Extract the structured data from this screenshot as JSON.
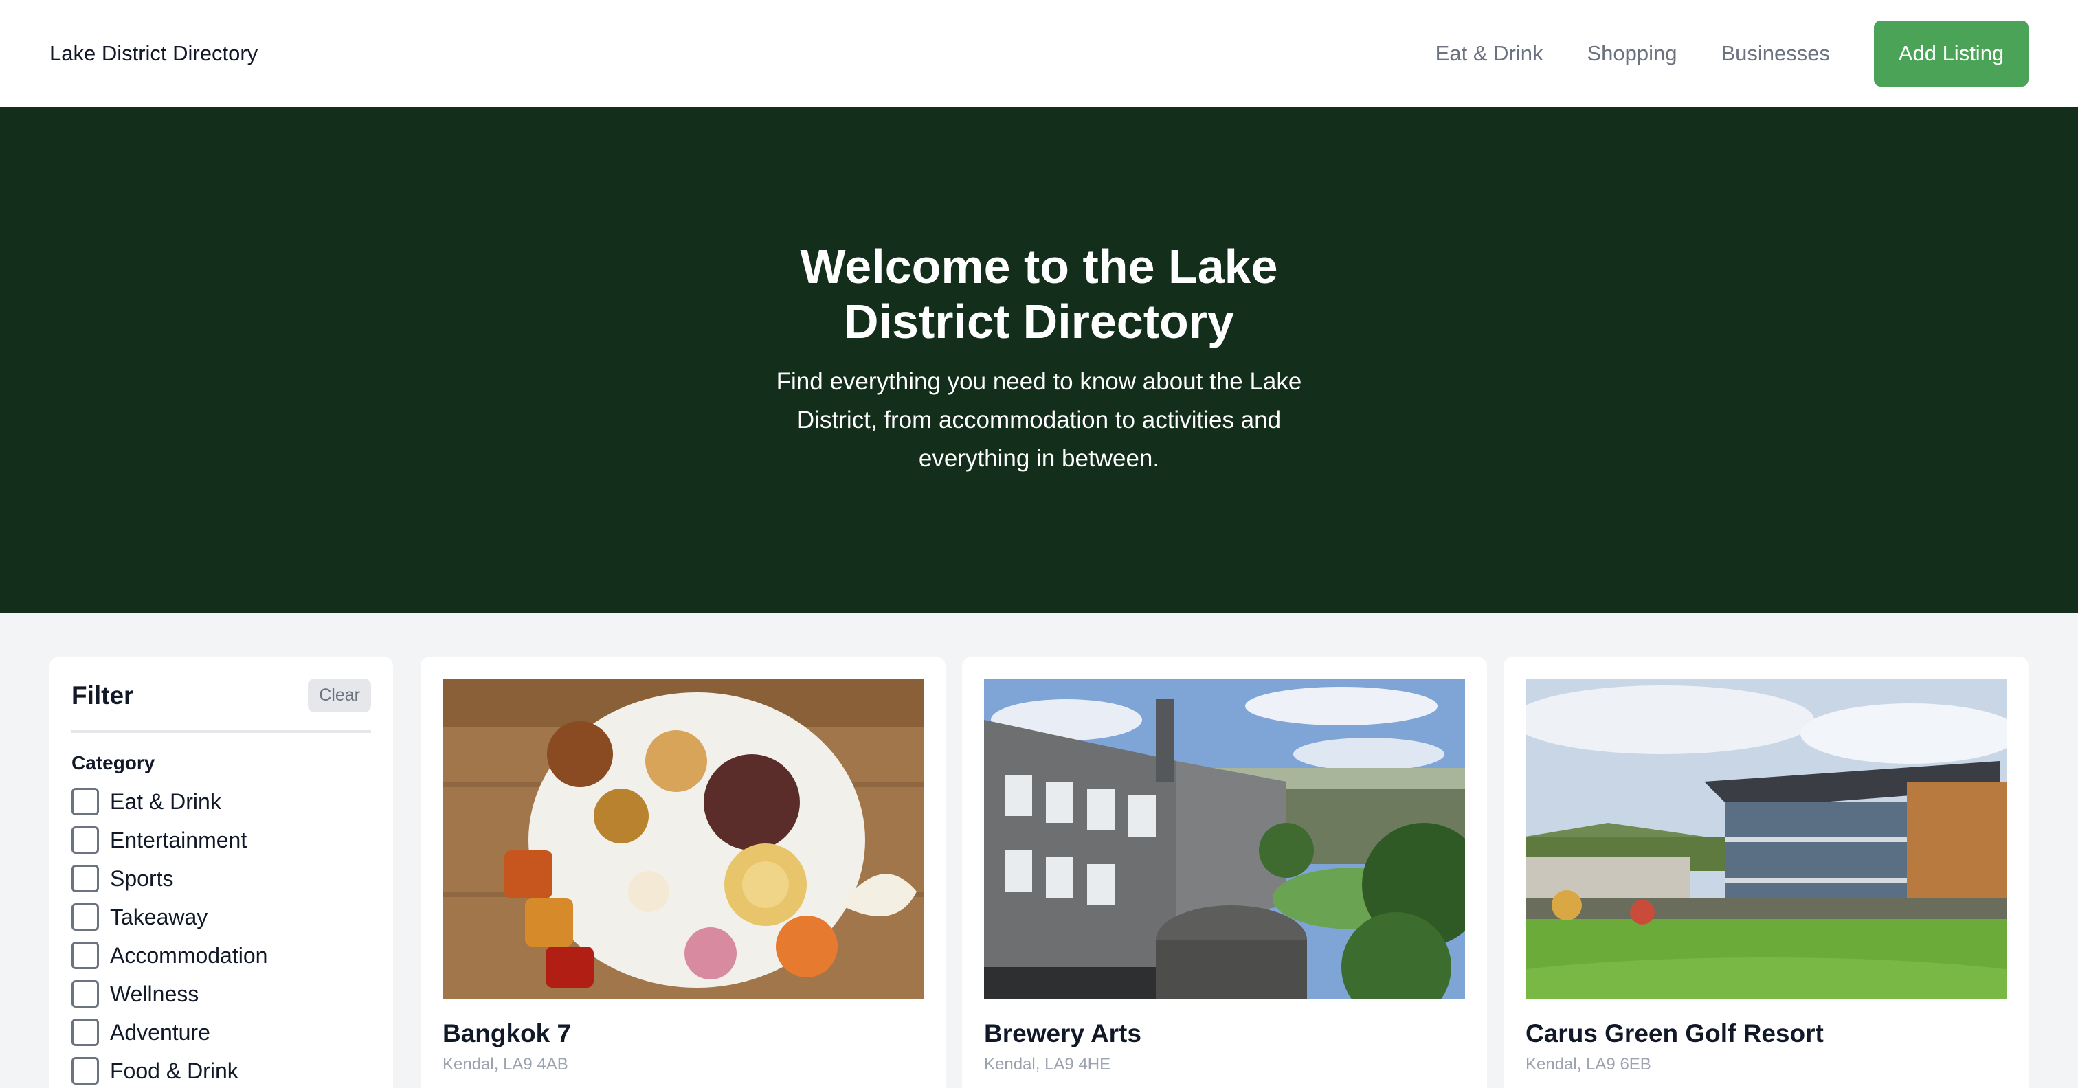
{
  "header": {
    "brand": "Lake District Directory",
    "nav": [
      "Eat & Drink",
      "Shopping",
      "Businesses"
    ],
    "cta": "Add Listing"
  },
  "hero": {
    "title": "Welcome to the Lake District Directory",
    "subtitle": "Find everything you need to know about the Lake District, from accommodation to activities and everything in between."
  },
  "filter": {
    "title": "Filter",
    "clear": "Clear",
    "category_label": "Category",
    "categories": [
      "Eat & Drink",
      "Entertainment",
      "Sports",
      "Takeaway",
      "Accommodation",
      "Wellness",
      "Adventure",
      "Food & Drink"
    ]
  },
  "listings": [
    {
      "name": "Bangkok 7",
      "location": "Kendal, LA9 4AB",
      "image": "thai-food-platter-photo"
    },
    {
      "name": "Brewery Arts",
      "location": "Kendal, LA9 4HE",
      "image": "stone-brewery-building-photo"
    },
    {
      "name": "Carus Green Golf Resort",
      "location": "Kendal, LA9 6EB",
      "image": "golf-clubhouse-photo"
    }
  ],
  "colors": {
    "accent": "#4aa356",
    "hero_bg": "#132e1a",
    "page_bg": "#f3f4f6"
  }
}
